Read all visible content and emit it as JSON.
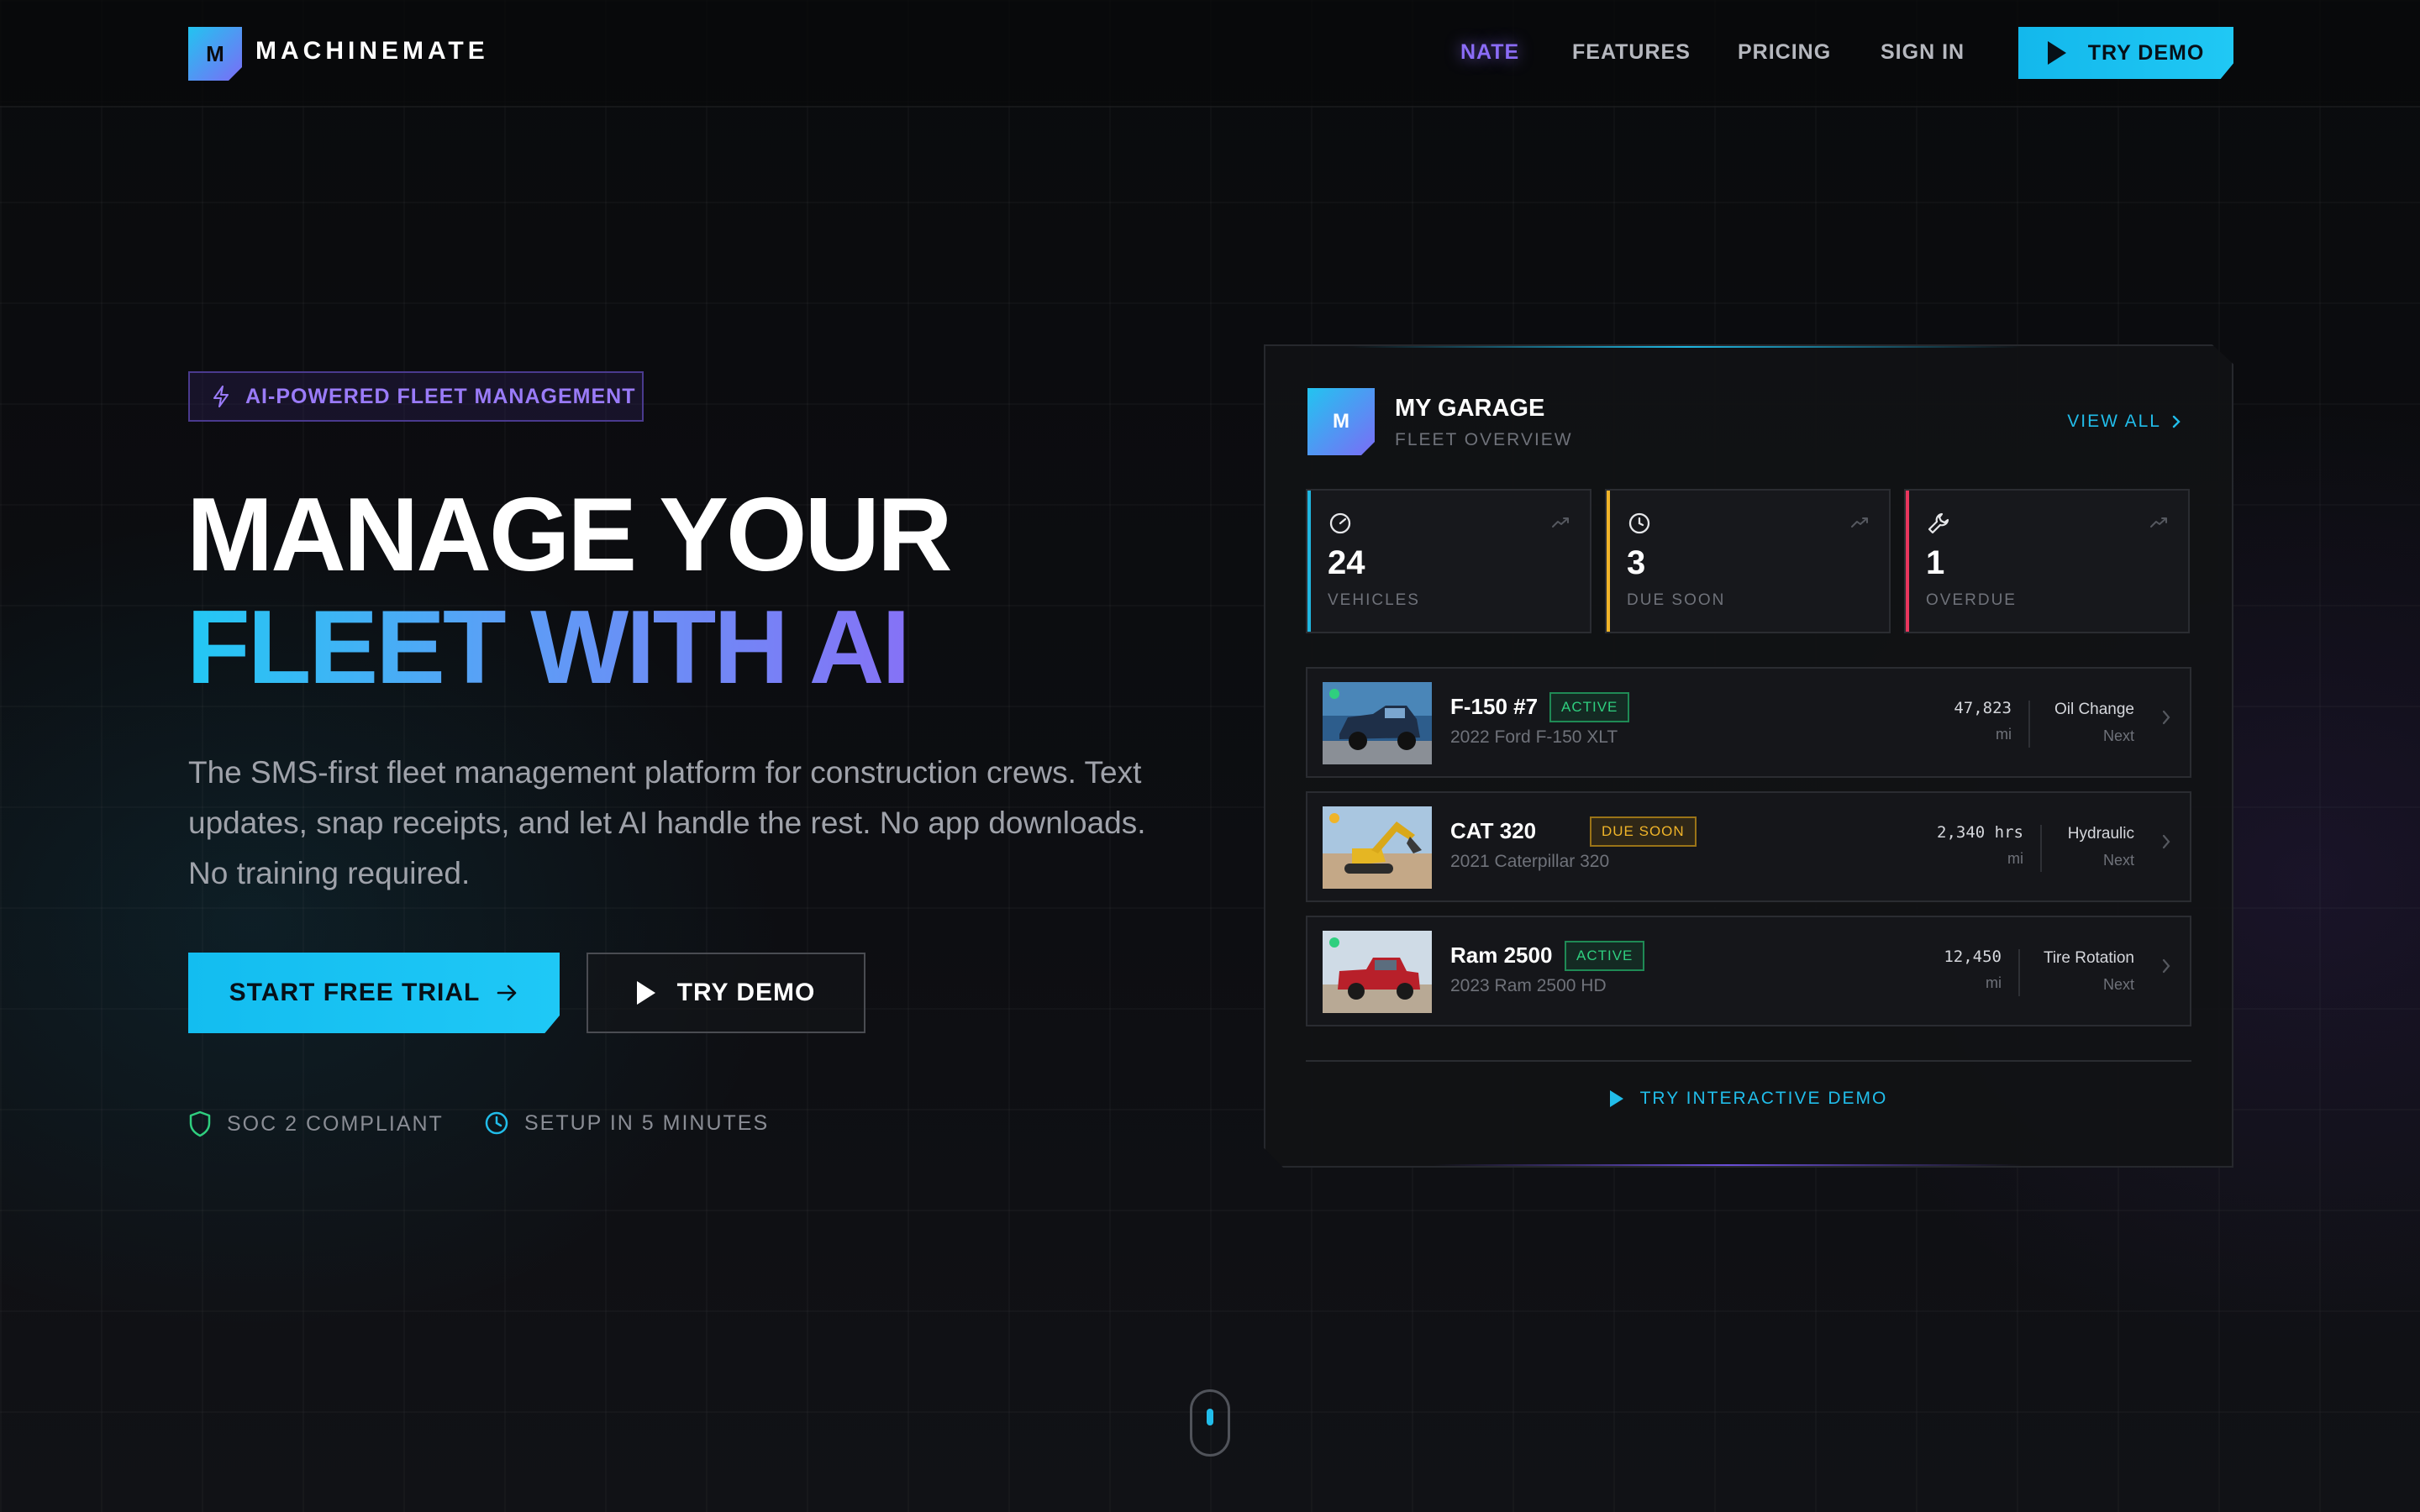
{
  "brand": {
    "logo_letter": "M",
    "name": "MACHINEMATE"
  },
  "nav": {
    "links": [
      "NATE",
      "FEATURES",
      "PRICING",
      "SIGN IN"
    ],
    "active": "NATE",
    "demo_label": "TRY DEMO"
  },
  "hero": {
    "badge": "AI-POWERED FLEET MANAGEMENT",
    "headline_line1": "MANAGE YOUR",
    "headline_line2": "FLEET WITH AI",
    "subtext": "The SMS-first fleet management platform for construction crews. Text updates, snap receipts, and let AI handle the rest. No app downloads. No training required.",
    "cta_primary": "START FREE TRIAL",
    "cta_secondary": "TRY DEMO",
    "trust": [
      "SOC 2 COMPLIANT",
      "SETUP IN 5 MINUTES"
    ]
  },
  "garage": {
    "logo_letter": "M",
    "title": "MY GARAGE",
    "subtitle": "FLEET OVERVIEW",
    "view_all": "VIEW ALL",
    "stats": [
      {
        "value": "24",
        "label": "VEHICLES",
        "color": "#1fb6e0",
        "icon": "gauge-icon"
      },
      {
        "value": "3",
        "label": "DUE SOON",
        "color": "#f0b429",
        "icon": "clock-icon"
      },
      {
        "value": "1",
        "label": "OVERDUE",
        "color": "#e9365d",
        "icon": "wrench-icon"
      }
    ],
    "vehicles": [
      {
        "name": "F-150 #7",
        "status": "ACTIVE",
        "model": "2022 Ford F-150 XLT",
        "miles": "47,823",
        "unit": "mi",
        "service": "Oil Change",
        "next": "Next",
        "dot": "#2fcf7f"
      },
      {
        "name": "CAT 320",
        "status": "DUE SOON",
        "model": "2021 Caterpillar 320",
        "miles": "2,340 hrs",
        "unit": "mi",
        "service": "Hydraulic",
        "next": "Next",
        "dot": "#f0b429"
      },
      {
        "name": "Ram 2500",
        "status": "ACTIVE",
        "model": "2023 Ram 2500 HD",
        "miles": "12,450",
        "unit": "mi",
        "service": "Tire Rotation",
        "next": "Next",
        "dot": "#2fcf7f"
      }
    ],
    "try_interactive": "TRY INTERACTIVE DEMO"
  },
  "colors": {
    "accent_cyan": "#1fb6e0",
    "accent_purple": "#8b6cf7",
    "background": "#0b0c0f"
  }
}
